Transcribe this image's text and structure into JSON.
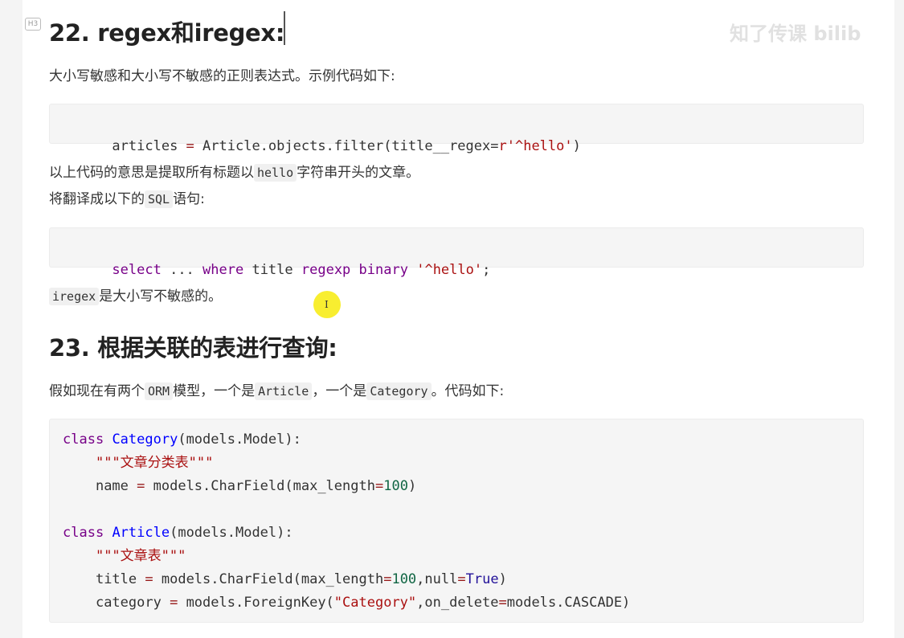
{
  "section22": {
    "badge": "H3",
    "title": "22. regex和iregex:",
    "desc": "大小写敏感和大小写不敏感的正则表达式。示例代码如下:",
    "code1": {
      "var": "articles",
      "eq": " = ",
      "call": "Article.objects.filter(title__regex=",
      "str": "r'^hello'",
      "close": ")"
    },
    "explain1_a": "以上代码的意思是提取所有标题以",
    "explain1_code": "hello",
    "explain1_b": "字符串开头的文章。",
    "explain2_a": "将翻译成以下的",
    "explain2_code": "SQL",
    "explain2_b": "语句:",
    "code2": {
      "kw1": "select",
      "mid1": " ... ",
      "kw2": "where",
      "mid2": " title ",
      "kw3": "regexp",
      "mid3": " ",
      "kw4": "binary",
      "mid4": " ",
      "str": "'^hello'",
      "end": ";"
    },
    "note_code": "iregex",
    "note_text": "是大小写不敏感的。"
  },
  "section23": {
    "title": "23. 根据关联的表进行查询:",
    "desc_a": "假如现在有两个",
    "desc_code1": "ORM",
    "desc_b": "模型，一个是",
    "desc_code2": "Article",
    "desc_c": "，一个是",
    "desc_code3": "Category",
    "desc_d": "。代码如下:",
    "code": {
      "l1_kw": "class",
      "l1_def": "Category",
      "l1_rest": "(models.Model):",
      "l2_str": "\"\"\"文章分类表\"\"\"",
      "l3_a": "name ",
      "l3_eq": "=",
      "l3_b": " models.CharField(max_length",
      "l3_eq2": "=",
      "l3_num": "100",
      "l3_c": ")",
      "l4_kw": "class",
      "l4_def": "Article",
      "l4_rest": "(models.Model):",
      "l5_str": "\"\"\"文章表\"\"\"",
      "l6_a": "title ",
      "l6_eq": "=",
      "l6_b": " models.CharField(max_length",
      "l6_eq2": "=",
      "l6_num": "100",
      "l6_c": ",null",
      "l6_eq3": "=",
      "l6_atom": "True",
      "l6_d": ")",
      "l7_a": "category ",
      "l7_eq": "=",
      "l7_b": " models.ForeignKey(",
      "l7_str": "\"Category\"",
      "l7_c": ",on_delete",
      "l7_eq2": "=",
      "l7_d": "models.CASCADE)"
    }
  },
  "cursor": {
    "glyph": "I"
  },
  "watermark": {
    "text": "知了传课  bilib"
  }
}
